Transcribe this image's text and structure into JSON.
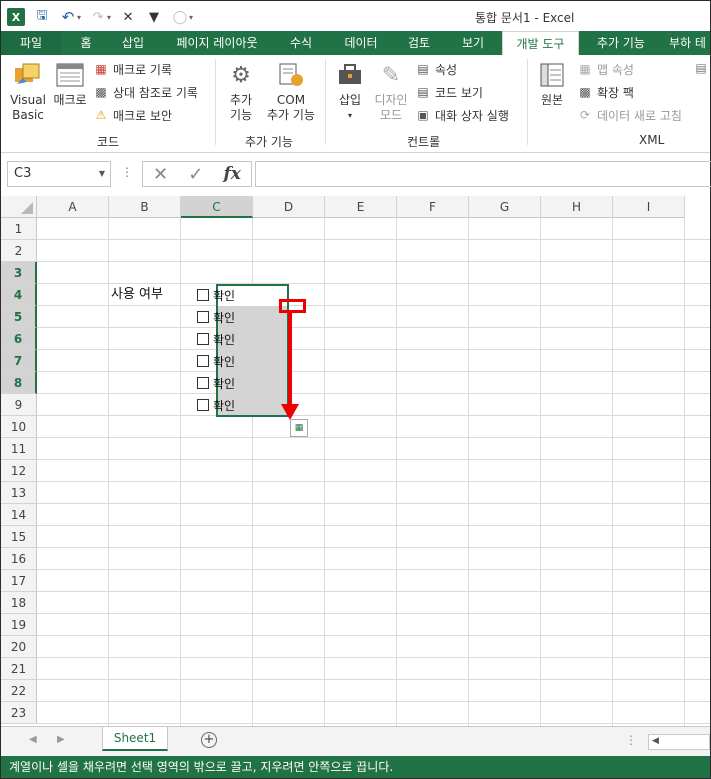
{
  "window": {
    "title": "통합 문서1 - Excel"
  },
  "qat": {
    "app_icon": "X"
  },
  "tabs": {
    "file": "파일",
    "items": [
      "홈",
      "삽입",
      "페이지 레이아웃",
      "수식",
      "데이터",
      "검토",
      "보기",
      "개발 도구",
      "추가 기능",
      "부하 테"
    ],
    "active": "개발 도구"
  },
  "ribbon": {
    "code": {
      "group_label": "코드",
      "visual_basic": "Visual Basic",
      "visual_basic_l1": "Visual",
      "visual_basic_l2": "Basic",
      "macro": "매크로",
      "record_macro": "매크로 기록",
      "relative_ref": "상대 참조로 기록",
      "macro_security": "매크로 보안"
    },
    "addins": {
      "group_label": "추가 기능",
      "addins_l1": "추가",
      "addins_l2": "기능",
      "com_l1": "COM",
      "com_l2": "추가 기능"
    },
    "controls": {
      "group_label": "컨트롤",
      "insert": "삽입",
      "design_l1": "디자인",
      "design_l2": "모드",
      "properties": "속성",
      "view_code": "코드 보기",
      "run_dialog": "대화 상자 실행"
    },
    "xml": {
      "group_label": "XML",
      "source": "원본",
      "map_properties": "맵 속성",
      "expansion_packs": "확장 팩",
      "refresh_data": "데이터 새로 고침"
    }
  },
  "formula_bar": {
    "name_box": "C3",
    "fx": "fx",
    "formula": ""
  },
  "columns": [
    "A",
    "B",
    "C",
    "D",
    "E",
    "F",
    "G",
    "H",
    "I"
  ],
  "rows": [
    "1",
    "2",
    "3",
    "4",
    "5",
    "6",
    "7",
    "8",
    "9",
    "10",
    "11",
    "12",
    "13",
    "14",
    "15",
    "16",
    "17",
    "18",
    "19",
    "20",
    "21",
    "22",
    "23"
  ],
  "selected_column": "C",
  "selected_rows": [
    "3",
    "4",
    "5",
    "6",
    "7",
    "8"
  ],
  "cells": {
    "B3": "사용 여부",
    "checkbox_label": "확인",
    "checkboxes": [
      "확인",
      "확인",
      "확인",
      "확인",
      "확인",
      "확인"
    ]
  },
  "sheets": {
    "tabs": [
      "Sheet1"
    ],
    "active": "Sheet1"
  },
  "status": {
    "message": "계열이나 셀을 채우려면 선택 영역의 밖으로 끌고, 지우려면 안쪽으로 끕니다."
  },
  "colors": {
    "accent": "#217346",
    "annotation": "#e00000"
  }
}
